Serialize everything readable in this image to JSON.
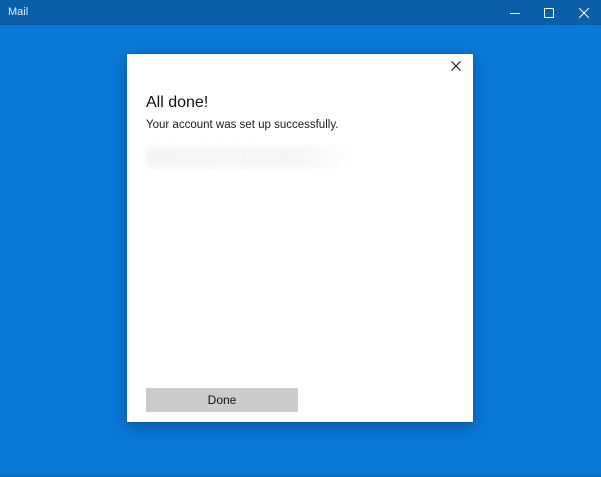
{
  "window": {
    "title": "Mail",
    "accent_color": "#0a78d7",
    "titlebar_color": "#0b5ea8",
    "controls": {
      "minimize_icon": "minimize-icon",
      "maximize_icon": "maximize-icon",
      "close_icon": "close-icon"
    }
  },
  "dialog": {
    "title": "All done!",
    "message": "Your account was set up successfully.",
    "close_icon": "close-icon",
    "done_label": "Done"
  }
}
